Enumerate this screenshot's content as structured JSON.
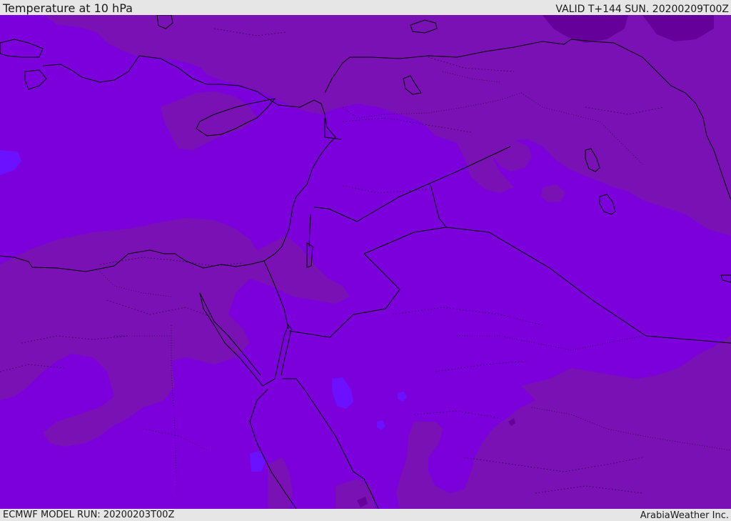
{
  "header": {
    "title": "Temperature at 10 hPa",
    "valid_time": "VALID T+144 SUN. 20200209T00Z"
  },
  "footer": {
    "model_run": "ECMWF MODEL RUN: 20200203T00Z",
    "credit": "ArabiaWeather Inc."
  },
  "map": {
    "colors": {
      "field_main": "#7c00dc",
      "field_warm": "#7a11b5",
      "field_cool": "#6b11ff",
      "field_dark": "#66009a",
      "coastline": "#000000",
      "border": "#000000"
    }
  }
}
